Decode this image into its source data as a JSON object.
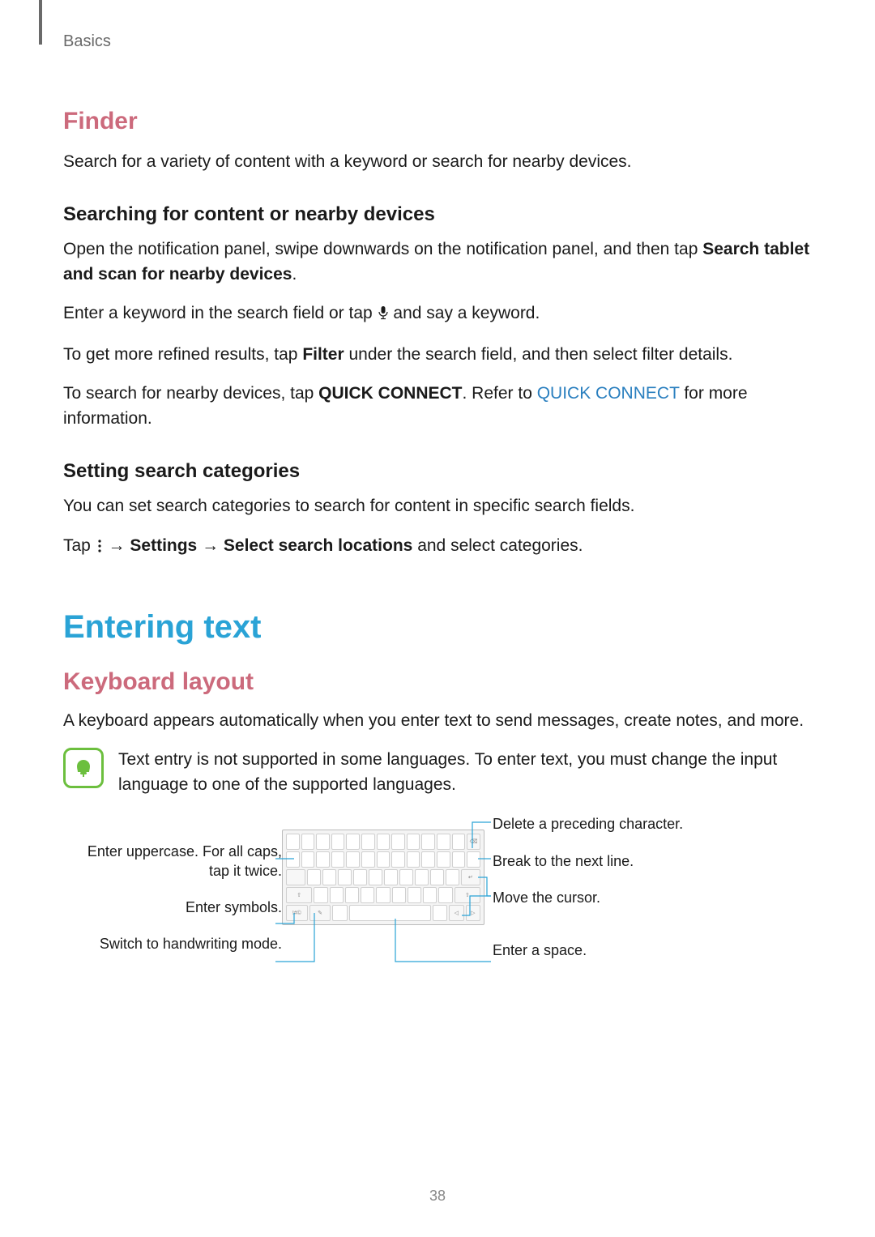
{
  "header": {
    "section": "Basics"
  },
  "finder": {
    "title": "Finder",
    "intro": "Search for a variety of content with a keyword or search for nearby devices.",
    "sub1_title": "Searching for content or nearby devices",
    "sub1_p1a": "Open the notification panel, swipe downwards on the notification panel, and then tap ",
    "sub1_p1b": "Search tablet and scan for nearby devices",
    "sub1_p1c": ".",
    "sub1_p2a": "Enter a keyword in the search field or tap ",
    "sub1_p2b": " and say a keyword.",
    "sub1_p3a": "To get more refined results, tap ",
    "sub1_p3b": "Filter",
    "sub1_p3c": " under the search field, and then select filter details.",
    "sub1_p4a": "To search for nearby devices, tap ",
    "sub1_p4b": "QUICK CONNECT",
    "sub1_p4c": ". Refer to ",
    "sub1_p4d": "QUICK CONNECT",
    "sub1_p4e": " for more information.",
    "sub2_title": "Setting search categories",
    "sub2_p1": "You can set search categories to search for content in specific search fields.",
    "sub2_p2a": "Tap ",
    "sub2_p2b": " → ",
    "sub2_p2c": "Settings",
    "sub2_p2d": " → ",
    "sub2_p2e": "Select search locations",
    "sub2_p2f": " and select categories."
  },
  "entering": {
    "title": "Entering text",
    "kl_title": "Keyboard layout",
    "kl_p1": "A keyboard appears automatically when you enter text to send messages, create notes, and more.",
    "note": "Text entry is not supported in some languages. To enter text, you must change the input language to one of the supported languages."
  },
  "callouts": {
    "left1": "Enter uppercase. For all caps, tap it twice.",
    "left2": "Enter symbols.",
    "left3": "Switch to handwriting mode.",
    "right1": "Delete a preceding character.",
    "right2": "Break to the next line.",
    "right3": "Move the cursor.",
    "right4": "Enter a space."
  },
  "page_number": "38"
}
